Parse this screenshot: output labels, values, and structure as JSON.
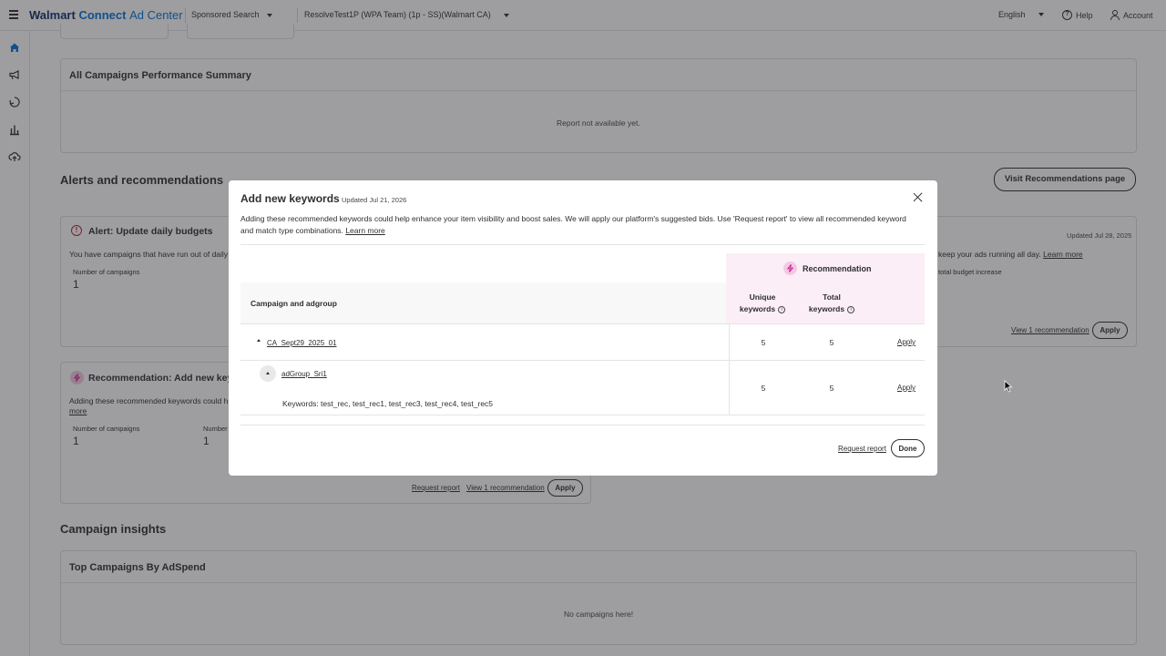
{
  "topbar": {
    "brand_walmart": "Walmart",
    "brand_connect": "Connect",
    "brand_adcenter": "Ad Center",
    "product_select": "Sponsored Search",
    "account_select": "ResolveTest1P (WPA Team) (1p - SS)(Walmart CA)",
    "language": "English",
    "help": "Help",
    "account": "Account"
  },
  "background": {
    "summary_title": "All Campaigns Performance Summary",
    "summary_empty": "Report not available yet.",
    "alerts_title": "Alerts and recommendations",
    "visit_button": "Visit Recommendations page",
    "alert_card": {
      "title": "Alert: Update daily budgets",
      "desc_start": "You have campaigns that have run out of daily",
      "label": "Number of campaigns",
      "value": "1"
    },
    "right_card": {
      "updated": "Updated Jul 28, 2025",
      "desc_end": "keep your ads running all day.",
      "learn_more": "Learn more",
      "budget_note": "total budget increase",
      "view_link": "View 1 recommendation",
      "apply": "Apply"
    },
    "rec_card": {
      "title": "Recommendation: Add new key",
      "desc_start": "Adding these recommended keywords could h",
      "more": "more",
      "label1": "Number of campaigns",
      "value1": "1",
      "label2": "Number",
      "value2": "1",
      "request_report": "Request report",
      "view_link": "View 1 recommendation",
      "apply": "Apply"
    },
    "insights_title": "Campaign insights",
    "top_campaigns_title": "Top Campaigns By AdSpend",
    "top_campaigns_empty": "No campaigns here!"
  },
  "modal": {
    "title": "Add new keywords",
    "updated": "Updated Jul 21, 2026",
    "description": "Adding these recommended keywords could help enhance your item visibility and boost sales. We will apply our platform's suggested bids. Use 'Request report' to view all recommended keyword and match type combinations.",
    "learn_more": "Learn more",
    "recommendation_label": "Recommendation",
    "columns": {
      "campaign": "Campaign and adgroup",
      "unique_line1": "Unique",
      "unique_line2": "keywords",
      "total_line1": "Total",
      "total_line2": "keywords"
    },
    "rows": [
      {
        "name": "CA_Sept29_2025_01",
        "unique": "5",
        "total": "5",
        "apply": "Apply"
      },
      {
        "name": "adGroup_Sri1",
        "keywords": "Keywords: test_rec, test_rec1, test_rec3, test_rec4, test_rec5",
        "unique": "5",
        "total": "5",
        "apply": "Apply"
      }
    ],
    "request_report": "Request report",
    "done": "Done"
  },
  "colors": {
    "brand_dark": "#0d2f6b",
    "brand_blue": "#0071dc",
    "rec_band": "#fbeef6",
    "alert_red": "#c8102e",
    "rec_pink": "#c6168d"
  }
}
